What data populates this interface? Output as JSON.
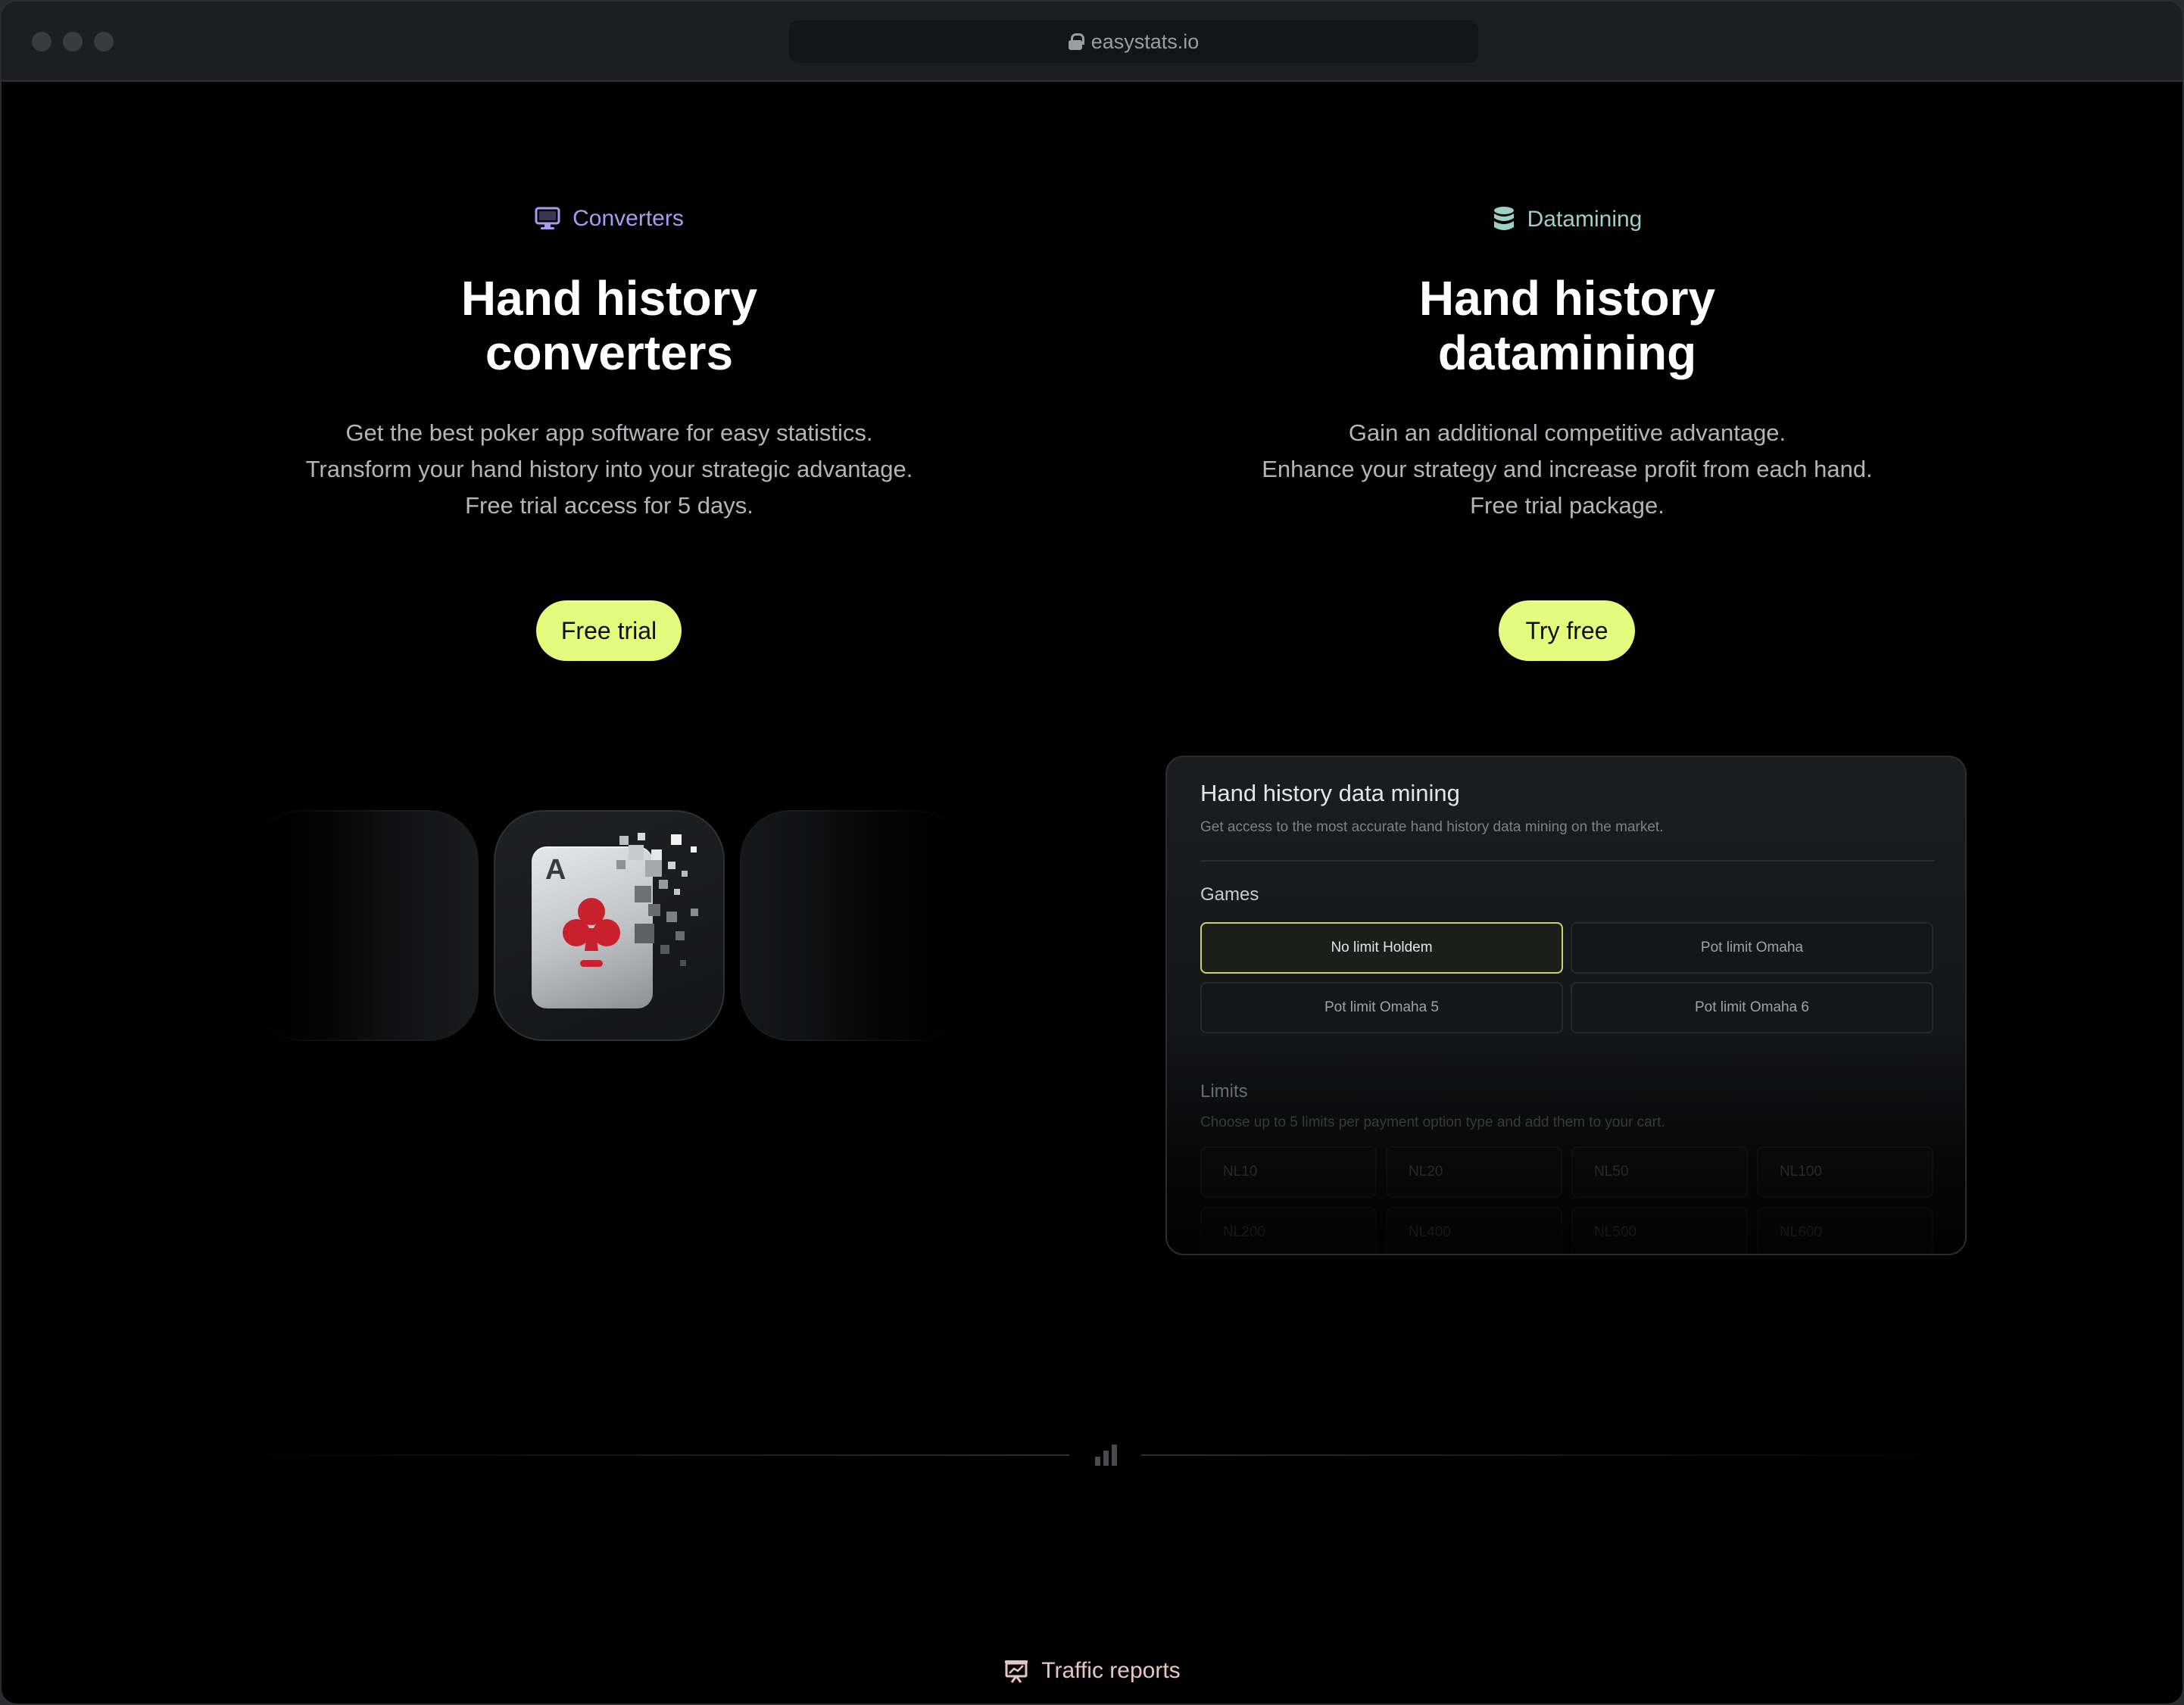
{
  "browser": {
    "url": "easystats.io"
  },
  "converters": {
    "eyebrow": "Converters",
    "eyebrow_icon": "monitor-icon",
    "eyebrow_color": "#a99bf0",
    "title_line1": "Hand history",
    "title_line2": "converters",
    "desc_line1": "Get the best poker app software for easy statistics.",
    "desc_line2": "Transform your hand history into your strategic advantage.",
    "desc_line3": "Free trial access for 5 days.",
    "cta": "Free trial",
    "card_rank": "A"
  },
  "datamining": {
    "eyebrow": "Datamining",
    "eyebrow_icon": "database-icon",
    "eyebrow_color": "#9ccfc8",
    "title_line1": "Hand history",
    "title_line2": "datamining",
    "desc_line1": "Gain an additional competitive advantage.",
    "desc_line2": "Enhance your strategy and increase profit from each hand.",
    "desc_line3": "Free trial package.",
    "cta": "Try free",
    "panel": {
      "title": "Hand history data mining",
      "subtitle": "Get access to the most accurate hand history data mining on the market.",
      "games_label": "Games",
      "games": [
        "No limit Holdem",
        "Pot limit Omaha",
        "Pot limit Omaha 5",
        "Pot limit Omaha 6"
      ],
      "selected_game": "No limit Holdem",
      "limits_label": "Limits",
      "limits_sub": "Choose up to 5 limits per payment option type and add them to your cart.",
      "limits": [
        "NL10",
        "NL20",
        "NL50",
        "NL100",
        "NL200",
        "NL400",
        "NL500",
        "NL600"
      ]
    }
  },
  "section_divider_icon": "bar-chart-icon",
  "next_section": {
    "label": "Traffic reports",
    "icon": "presentation-chart-icon",
    "color": "#e8c5c5"
  },
  "colors": {
    "accent": "#e4fb7d",
    "background": "#000000"
  }
}
